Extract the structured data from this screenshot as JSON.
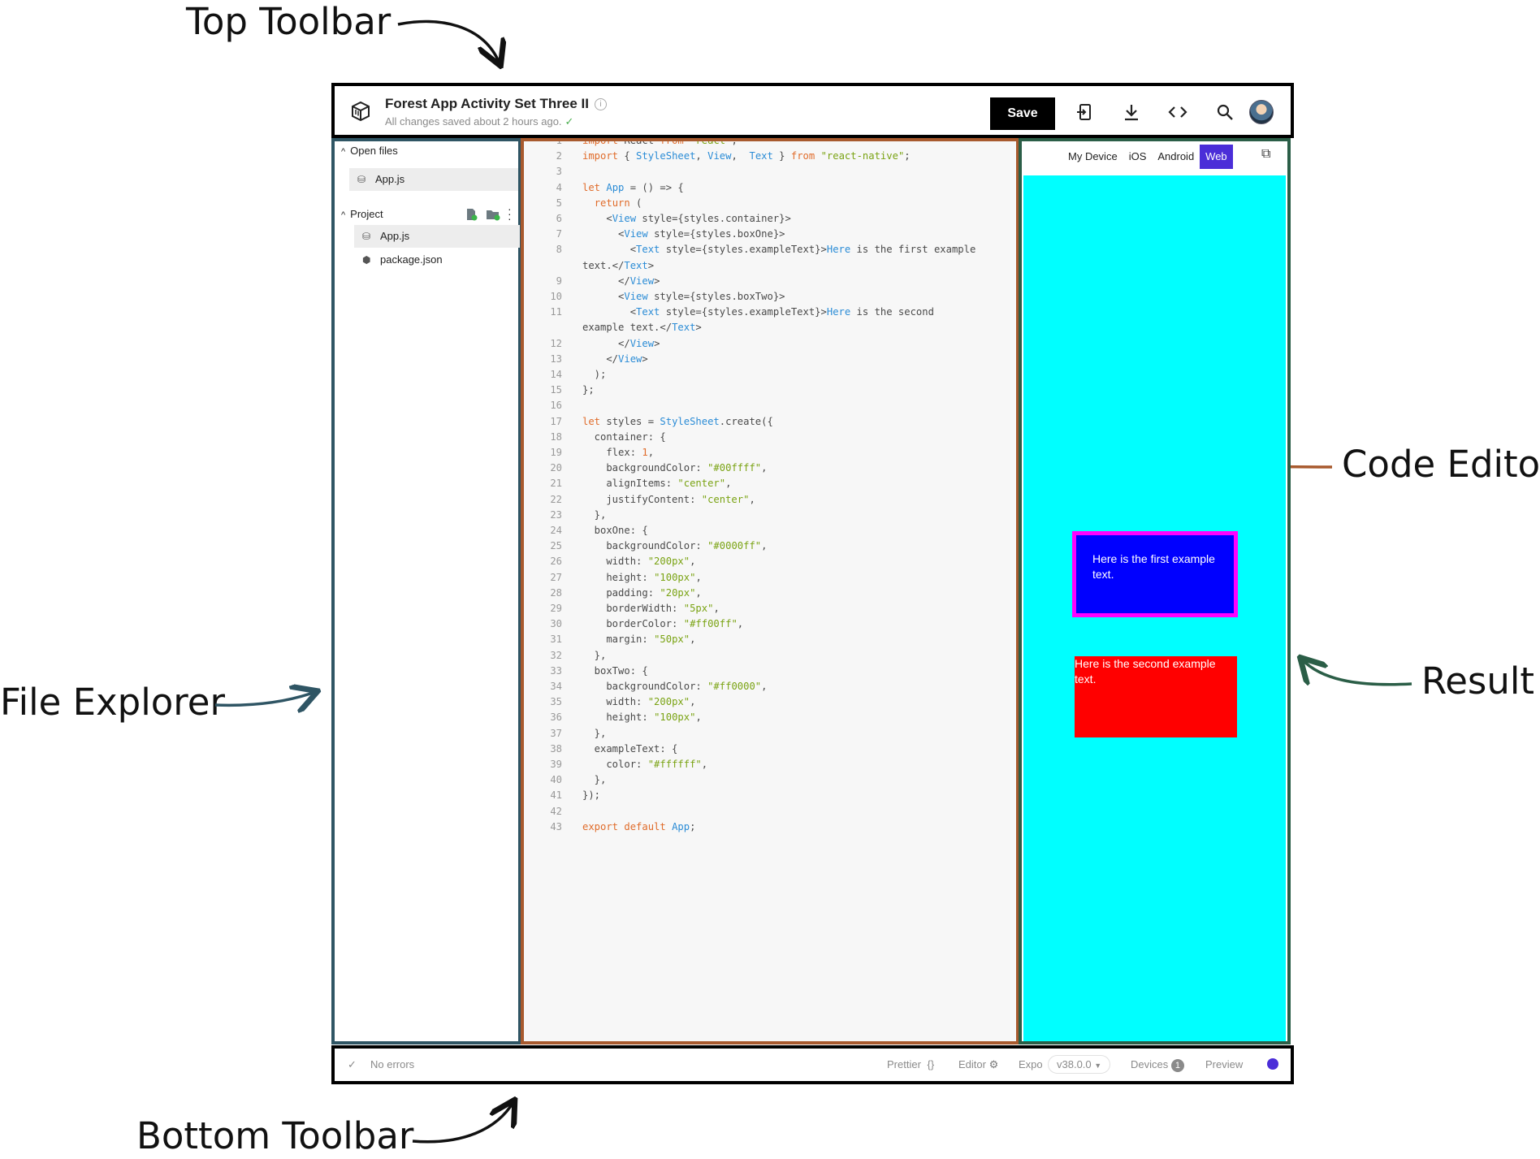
{
  "annotations": {
    "top": "Top Toolbar",
    "editor": "Code Editor",
    "explorer": "File Explorer",
    "result": "Result",
    "bottom": "Bottom Toolbar"
  },
  "colors": {
    "explorer_border": "#2f5564",
    "editor_border": "#a85a2e",
    "result_border": "#2b5e47",
    "accent": "#4b2ed8",
    "preview_bg": "#00ffff",
    "box_one_bg": "#0000ff",
    "box_one_border": "#ff00ff",
    "box_two_bg": "#ff0000"
  },
  "top_toolbar": {
    "project_title": "Forest App Activity Set Three II",
    "save_status": "All changes saved about 2 hours ago.",
    "save_label": "Save",
    "icons": [
      "device-import-icon",
      "download-icon",
      "embed-code-icon",
      "search-icon",
      "user-avatar"
    ]
  },
  "explorer": {
    "open_files_label": "Open files",
    "open_files": [
      "App.js"
    ],
    "project_label": "Project",
    "project_files": [
      "App.js",
      "package.json"
    ]
  },
  "editor": {
    "lines": [
      {
        "n": "1",
        "t": "import React from 'react';"
      },
      {
        "n": "2",
        "t": "import { StyleSheet, View,  Text } from \"react-native\";"
      },
      {
        "n": "3",
        "t": ""
      },
      {
        "n": "4",
        "t": "let App = () => {"
      },
      {
        "n": "5",
        "t": "  return ("
      },
      {
        "n": "6",
        "t": "    <View style={styles.container}>"
      },
      {
        "n": "7",
        "t": "      <View style={styles.boxOne}>"
      },
      {
        "n": "8",
        "t": "        <Text style={styles.exampleText}>Here is the first example"
      },
      {
        "n": "",
        "t": "text.</Text>"
      },
      {
        "n": "9",
        "t": "      </View>"
      },
      {
        "n": "10",
        "t": "      <View style={styles.boxTwo}>"
      },
      {
        "n": "11",
        "t": "        <Text style={styles.exampleText}>Here is the second"
      },
      {
        "n": "",
        "t": "example text.</Text>"
      },
      {
        "n": "12",
        "t": "      </View>"
      },
      {
        "n": "13",
        "t": "    </View>"
      },
      {
        "n": "14",
        "t": "  );"
      },
      {
        "n": "15",
        "t": "};"
      },
      {
        "n": "16",
        "t": ""
      },
      {
        "n": "17",
        "t": "let styles = StyleSheet.create({"
      },
      {
        "n": "18",
        "t": "  container: {"
      },
      {
        "n": "19",
        "t": "    flex: 1,"
      },
      {
        "n": "20",
        "t": "    backgroundColor: \"#00ffff\","
      },
      {
        "n": "21",
        "t": "    alignItems: \"center\","
      },
      {
        "n": "22",
        "t": "    justifyContent: \"center\","
      },
      {
        "n": "23",
        "t": "  },"
      },
      {
        "n": "24",
        "t": "  boxOne: {"
      },
      {
        "n": "25",
        "t": "    backgroundColor: \"#0000ff\","
      },
      {
        "n": "26",
        "t": "    width: \"200px\","
      },
      {
        "n": "27",
        "t": "    height: \"100px\","
      },
      {
        "n": "28",
        "t": "    padding: \"20px\","
      },
      {
        "n": "29",
        "t": "    borderWidth: \"5px\","
      },
      {
        "n": "30",
        "t": "    borderColor: \"#ff00ff\","
      },
      {
        "n": "31",
        "t": "    margin: \"50px\","
      },
      {
        "n": "32",
        "t": "  },"
      },
      {
        "n": "33",
        "t": "  boxTwo: {"
      },
      {
        "n": "34",
        "t": "    backgroundColor: \"#ff0000\","
      },
      {
        "n": "35",
        "t": "    width: \"200px\","
      },
      {
        "n": "36",
        "t": "    height: \"100px\","
      },
      {
        "n": "37",
        "t": "  },"
      },
      {
        "n": "38",
        "t": "  exampleText: {"
      },
      {
        "n": "39",
        "t": "    color: \"#ffffff\","
      },
      {
        "n": "40",
        "t": "  },"
      },
      {
        "n": "41",
        "t": "});"
      },
      {
        "n": "42",
        "t": ""
      },
      {
        "n": "43",
        "t": "export default App;"
      }
    ]
  },
  "result": {
    "tabs": [
      "My Device",
      "iOS",
      "Android",
      "Web"
    ],
    "active_tab": "Web",
    "box_one_text": "Here is the first example text.",
    "box_two_text": "Here is the second example text."
  },
  "bottom_toolbar": {
    "errors": "No errors",
    "prettier": "Prettier",
    "prettier_icon": "{}",
    "editor": "Editor",
    "expo": "Expo",
    "version": "v38.0.0",
    "devices": "Devices",
    "devices_count": "1",
    "preview": "Preview"
  }
}
